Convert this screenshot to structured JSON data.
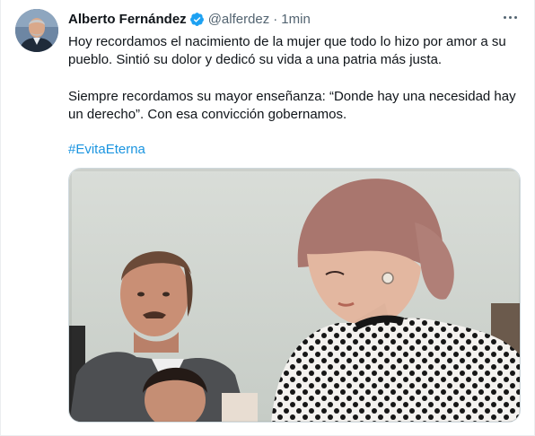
{
  "tweet": {
    "author": {
      "name": "Alberto Fernández",
      "handle": "@alferdez",
      "avatar_icon": "person-portrait",
      "verified": true,
      "verified_color": "#1da1f2"
    },
    "separator": "·",
    "time": "1min",
    "more_icon": "more-horizontal-icon",
    "paragraphs": [
      "Hoy recordamos el nacimiento de la mujer que todo lo hizo por amor a su pueblo. Sintió su dolor y dedicó su vida a una patria más justa.",
      "Siempre recordamos su mayor enseñanza: “Donde hay una necesidad hay un derecho”. Con esa convicción gobernamos."
    ],
    "hashtag": "#EvitaEterna",
    "hashtag_color": "#1b95e0",
    "media": {
      "type": "photo",
      "content": "colorized-historic-photo"
    }
  }
}
